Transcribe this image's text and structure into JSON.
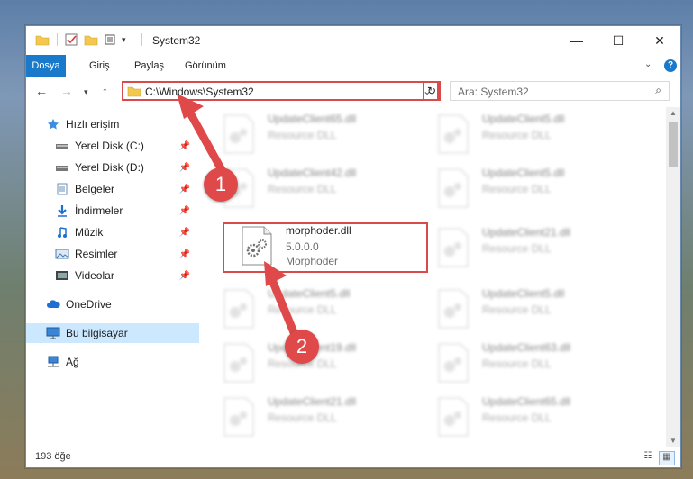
{
  "window": {
    "title": "System32",
    "controls": {
      "minimize": "—",
      "maximize": "☐",
      "close": "✕"
    }
  },
  "ribbon": {
    "tabs": [
      "Dosya",
      "Giriş",
      "Paylaş",
      "Görünüm"
    ],
    "help": "?"
  },
  "address": {
    "path": "C:\\Windows\\System32",
    "search_placeholder": "Ara: System32"
  },
  "nav": {
    "items": [
      {
        "label": "Hızlı erişim",
        "icon": "star-icon"
      },
      {
        "label": "Yerel Disk (C:)",
        "icon": "drive-icon",
        "pinned": true
      },
      {
        "label": "Yerel Disk (D:)",
        "icon": "drive-icon",
        "pinned": true
      },
      {
        "label": "Belgeler",
        "icon": "document-icon",
        "pinned": true
      },
      {
        "label": "İndirmeler",
        "icon": "download-icon",
        "pinned": true
      },
      {
        "label": "Müzik",
        "icon": "music-icon",
        "pinned": true
      },
      {
        "label": "Resimler",
        "icon": "pictures-icon",
        "pinned": true
      },
      {
        "label": "Videolar",
        "icon": "video-icon",
        "pinned": true
      },
      {
        "label": "OneDrive",
        "icon": "cloud-icon"
      },
      {
        "label": "Bu bilgisayar",
        "icon": "computer-icon",
        "selected": true
      },
      {
        "label": "Ağ",
        "icon": "network-icon"
      }
    ]
  },
  "files": {
    "left": [
      {
        "name": "UpdateClient65.dll",
        "line2": "Resource DLL"
      },
      {
        "name": "UpdateClient42.dll",
        "line2": "Resource DLL"
      },
      {
        "name": "morphoder.dll",
        "line2": "5.0.0.0",
        "line3": "Morphoder",
        "highlighted": true
      },
      {
        "name": "UpdateClient5.dll",
        "line2": "Resource DLL"
      },
      {
        "name": "UpdateClient19.dll",
        "line2": "Resource DLL"
      },
      {
        "name": "UpdateClient21.dll",
        "line2": "Resource DLL"
      }
    ],
    "right": [
      {
        "name": "UpdateClient5.dll",
        "line2": "Resource DLL"
      },
      {
        "name": "UpdateClient5.dll",
        "line2": "Resource DLL"
      },
      {
        "name": "UpdateClient21.dll",
        "line2": "Resource DLL"
      },
      {
        "name": "UpdateClient5.dll",
        "line2": "Resource DLL"
      },
      {
        "name": "UpdateClient63.dll",
        "line2": "Resource DLL"
      },
      {
        "name": "UpdateClient65.dll",
        "line2": "Resource DLL"
      }
    ]
  },
  "status": {
    "count": "193 öğe"
  },
  "callouts": [
    "1",
    "2"
  ],
  "colors": {
    "accent": "#1979ca",
    "highlight": "#d94a4a",
    "selection": "#cce8ff"
  }
}
